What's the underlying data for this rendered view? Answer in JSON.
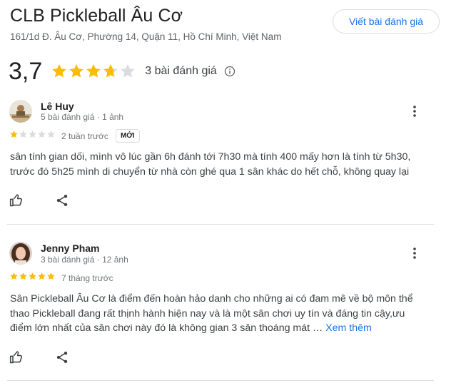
{
  "place": {
    "title": "CLB Pickleball Âu Cơ",
    "address": "161/1d Đ. Âu Cơ, Phường 14, Quận 11, Hồ Chí Minh, Việt Nam",
    "write_review_label": "Viết bài đánh giá",
    "rating_value": "3,7",
    "rating_stars": 3.7,
    "review_count": "3 bài đánh giá"
  },
  "reviews": [
    {
      "name": "Lê Huy",
      "meta": "5 bài đánh giá · 1 ảnh",
      "stars": 1,
      "time": "2 tuần trước",
      "badge": "MỚI",
      "text_line1": "sân tính gian dối, mình vô lúc gần 6h đánh tới 7h30 mà tính 400 mấy hơn là tính từ 5h30,",
      "text_line2": "trước đó 5h25 mình di chuyển từ nhà còn ghé qua 1 sân khác do hết chỗ, không quay lại"
    },
    {
      "name": "Jenny Pham",
      "meta": "3 bài đánh giá · 12 ảnh",
      "stars": 5,
      "time": "7 tháng trước",
      "text_line1": "Sân Pickleball Âu Cơ là điểm đến hoàn hảo danh cho những ai có đam mê về bộ môn thể",
      "text_line2": "thao Pickleball đang rất thịnh hành hiện nay và là một sân chơi uy tín và đáng tin cậy,ưu",
      "text_line3": "điểm lớn nhất của sân chơi này đó là không gian 3 sân thoáng mát …",
      "more_label": "Xem thêm"
    }
  ],
  "colors": {
    "star_filled": "#fbbc04",
    "star_empty": "#dadce0",
    "link": "#1a73e8"
  },
  "icons": [
    "info-icon",
    "more-vert-icon",
    "thumb-up-icon",
    "share-icon"
  ]
}
